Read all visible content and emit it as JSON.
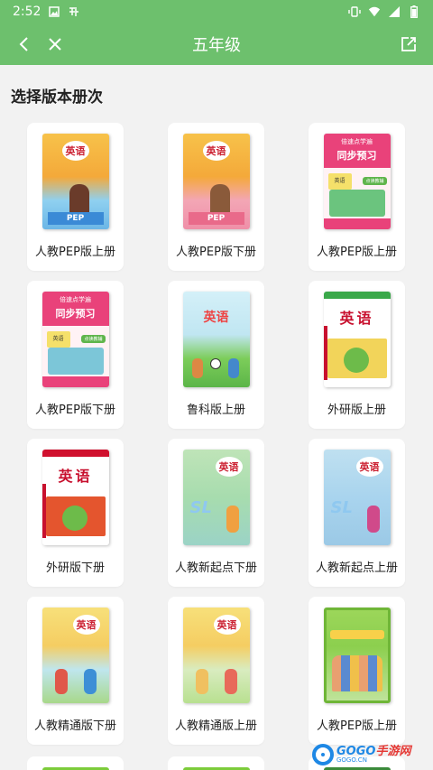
{
  "status_bar": {
    "time": "2:52",
    "left_icons": [
      "image-icon",
      "app-notification-icon"
    ],
    "right_icons": [
      "vibrate-icon",
      "wifi-icon",
      "signal-icon",
      "battery-icon"
    ]
  },
  "header": {
    "title": "五年级",
    "back_icon": "chevron-left-icon",
    "close_icon": "close-icon",
    "share_icon": "share-icon"
  },
  "section": {
    "title": "选择版本册次"
  },
  "books": [
    {
      "label": "人教PEP版上册",
      "cover_style": "pep",
      "badge": "英语",
      "footer": "PEP"
    },
    {
      "label": "人教PEP版下册",
      "cover_style": "pep",
      "badge": "英语",
      "footer": "PEP"
    },
    {
      "label": "人教PEP版上册",
      "cover_style": "sync",
      "top1": "倍速点学遍",
      "top2": "同步预习",
      "cover_label": "英语",
      "tag": "点读教辅"
    },
    {
      "label": "人教PEP版下册",
      "cover_style": "sync",
      "top1": "倍速点学遍",
      "top2": "同步预习",
      "cover_label": "英语",
      "tag": "点读教辅"
    },
    {
      "label": "鲁科版上册",
      "cover_style": "lk",
      "cover_title": "英语"
    },
    {
      "label": "外研版上册",
      "cover_style": "wy",
      "cover_title": "英语"
    },
    {
      "label": "外研版下册",
      "cover_style": "wy",
      "cover_title": "英语"
    },
    {
      "label": "人教新起点下册",
      "cover_style": "xqd",
      "badge": "英语",
      "letters": "SL"
    },
    {
      "label": "人教新起点上册",
      "cover_style": "xqd",
      "badge": "英语",
      "letters": "SL"
    },
    {
      "label": "人教精通版下册",
      "cover_style": "jt",
      "badge": "英语"
    },
    {
      "label": "人教精通版上册",
      "cover_style": "jt",
      "badge": "英语"
    },
    {
      "label": "人教PEP版上册",
      "cover_style": "pepold"
    }
  ],
  "watermark": {
    "brand_a": "GOGO",
    "brand_b": "手游网",
    "domain": "GOGO.CN"
  },
  "colors": {
    "header_bg": "#6dc06d",
    "page_bg": "#f2f2f2",
    "card_bg": "#ffffff",
    "watermark_blue": "#1e88e5"
  }
}
